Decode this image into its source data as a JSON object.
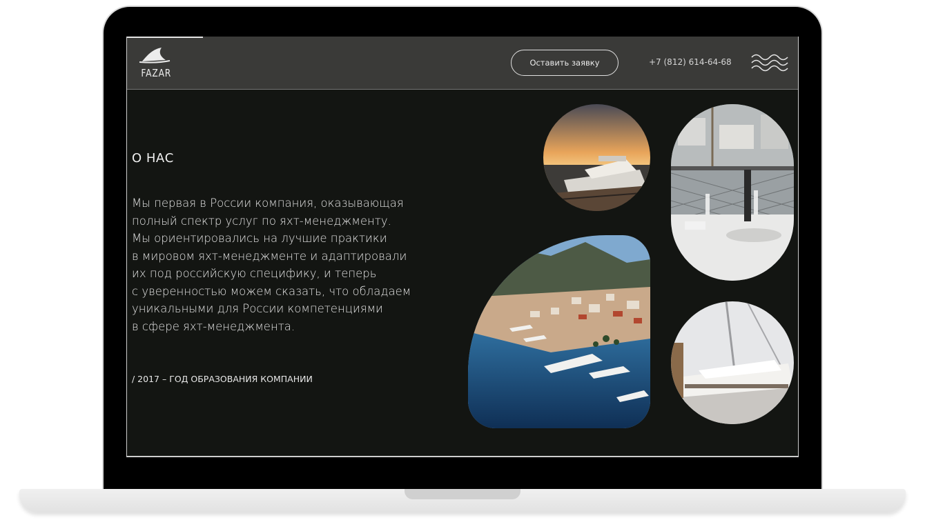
{
  "brand": {
    "name": "FAZAR"
  },
  "header": {
    "cta_label": "Оставить заявку",
    "phone": "+7 (812) 614-64-68",
    "menu_icon": "waves-menu-icon"
  },
  "about": {
    "title": "О НАС",
    "lines": [
      "Мы первая в России компания, оказывающая",
      "полный спектр услуг по яхт-менеджменту.",
      "Мы ориентировались на лучшие практики",
      "в мировом яхт-менеджменте и адаптировали",
      "их под российскую специфику, и теперь",
      "с уверенностью можем сказать, что обладаем",
      "уникальными для России компетенциями",
      "в сфере яхт-менеджмента."
    ],
    "founded": "/ 2017 – ГОД ОБРАЗОВАНИЯ КОМПАНИИ"
  },
  "colors": {
    "background": "#131512",
    "header": "#3a3a38",
    "text": "#e4e4e4"
  }
}
